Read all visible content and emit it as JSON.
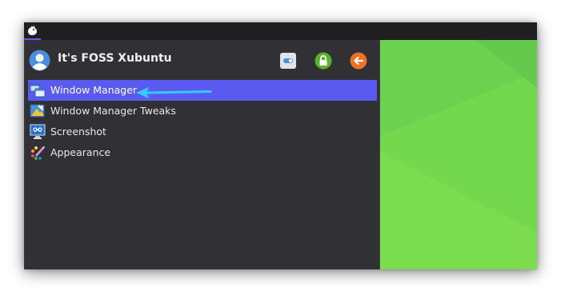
{
  "panel": {
    "whisker_icon": "whisker-menu-icon"
  },
  "menu": {
    "username": "It's FOSS Xubuntu",
    "header_actions": [
      {
        "name": "settings-toggle-icon",
        "color": "#4a90e2"
      },
      {
        "name": "lock-icon",
        "color": "#59b22a"
      },
      {
        "name": "logout-icon",
        "color": "#f07226"
      }
    ],
    "items": [
      {
        "label": "Window Manager",
        "icon": "window-manager-icon",
        "selected": true
      },
      {
        "label": "Window Manager Tweaks",
        "icon": "window-manager-tweaks-icon",
        "selected": false
      },
      {
        "label": "Screenshot",
        "icon": "screenshot-icon",
        "selected": false
      },
      {
        "label": "Appearance",
        "icon": "appearance-icon",
        "selected": false
      }
    ]
  },
  "colors": {
    "selection": "#5a59f0",
    "menu_bg": "#303035",
    "wallpaper": "#6bd14f",
    "annotation_arrow": "#33ccff"
  }
}
